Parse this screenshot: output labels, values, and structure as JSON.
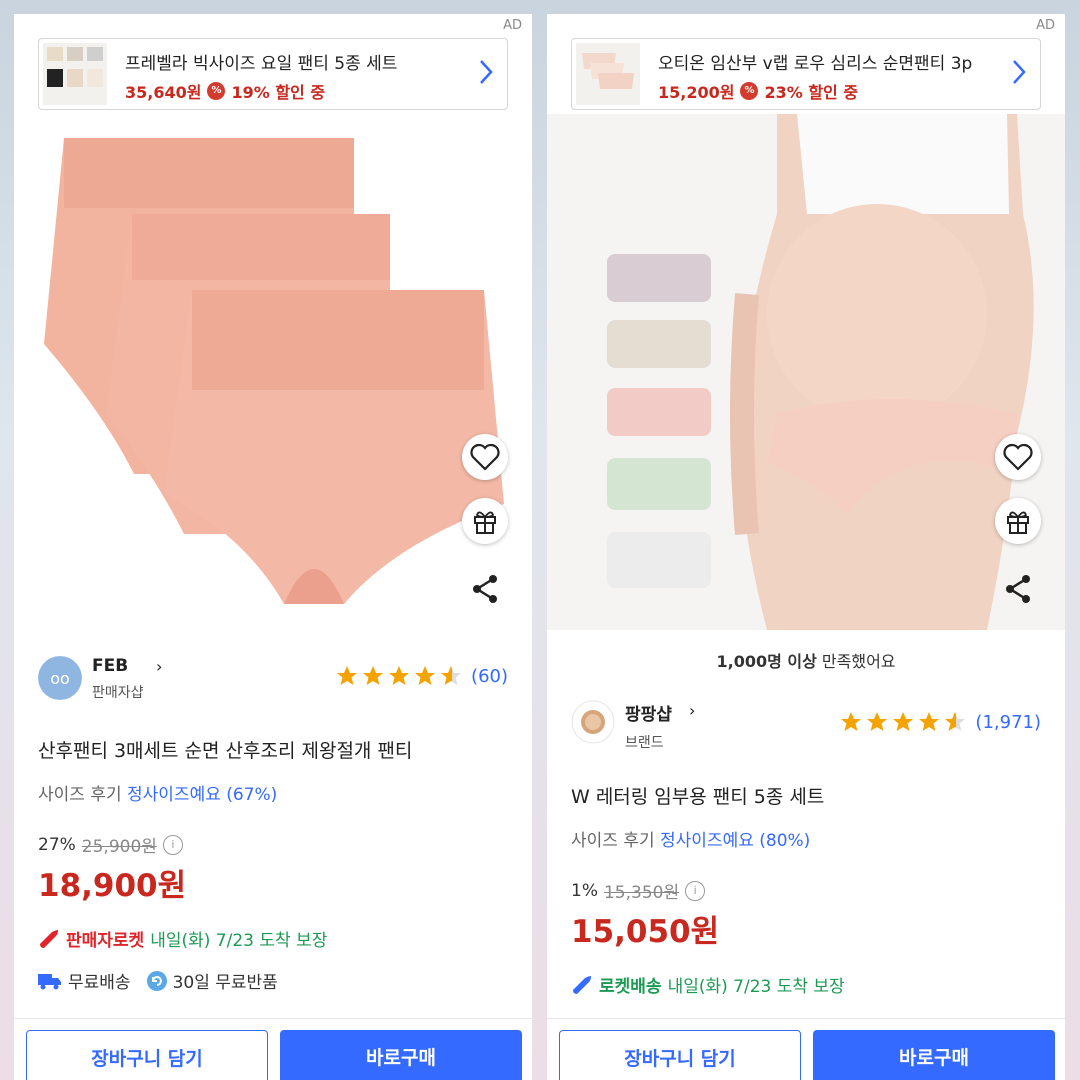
{
  "left": {
    "ad": {
      "tag": "AD",
      "title": "프레벨라 빅사이즈 요일 팬티 5종 세트",
      "price": "35,640원",
      "discount": "19% 할인 중"
    },
    "seller": {
      "name": "FEB",
      "type": "판매자샵"
    },
    "rating": {
      "stars": 4.5,
      "count": "(60)"
    },
    "title": "산후팬티 3매세트 순면 산후조리 제왕절개 팬티",
    "size_review": {
      "label": "사이즈 후기",
      "value": "정사이즈예요 (67%)"
    },
    "discount_rate": "27%",
    "original_price": "25,900원",
    "price": "18,900원",
    "delivery": {
      "badge": "판매자로켓",
      "text": "내일(화) 7/23 도착 보장"
    },
    "shipping": {
      "free": "무료배송",
      "return": "30일 무료반품"
    },
    "buttons": {
      "cart": "장바구니 담기",
      "buy": "바로구매"
    },
    "colors": {
      "panty": "#f2b39f",
      "waistband": "#eea995"
    }
  },
  "right": {
    "ad": {
      "tag": "AD",
      "title": "오티온 임산부 v랩 로우 심리스 순면팬티 3p",
      "price": "15,200원",
      "discount": "23% 할인 중"
    },
    "satisfied": {
      "bold": "1,000명 이상",
      "rest": " 만족했어요"
    },
    "seller": {
      "name": "팡팡샵",
      "type": "브랜드"
    },
    "rating": {
      "stars": 4.5,
      "count": "(1,971)"
    },
    "title": "W 레터링 임부용 팬티 5종 세트",
    "size_review": {
      "label": "사이즈 후기",
      "value": "정사이즈예요 (80%)"
    },
    "discount_rate": "1%",
    "original_price": "15,350원",
    "price": "15,050원",
    "delivery": {
      "badge": "로켓배송",
      "text": "내일(화) 7/23 도착 보장"
    },
    "buttons": {
      "cart": "장바구니 담기",
      "buy": "바로구매"
    },
    "swatches": [
      "#d9cdd3",
      "#e6ddd2",
      "#f2cbc6",
      "#d4e6d2",
      "#ececec"
    ]
  },
  "icons": [
    "heart-icon",
    "gift-icon",
    "share-icon",
    "chevron-right-icon",
    "star-icon",
    "info-icon",
    "truck-icon",
    "return-icon",
    "rocket-icon"
  ],
  "accent": "#346aff",
  "price_red": "#c8281e"
}
